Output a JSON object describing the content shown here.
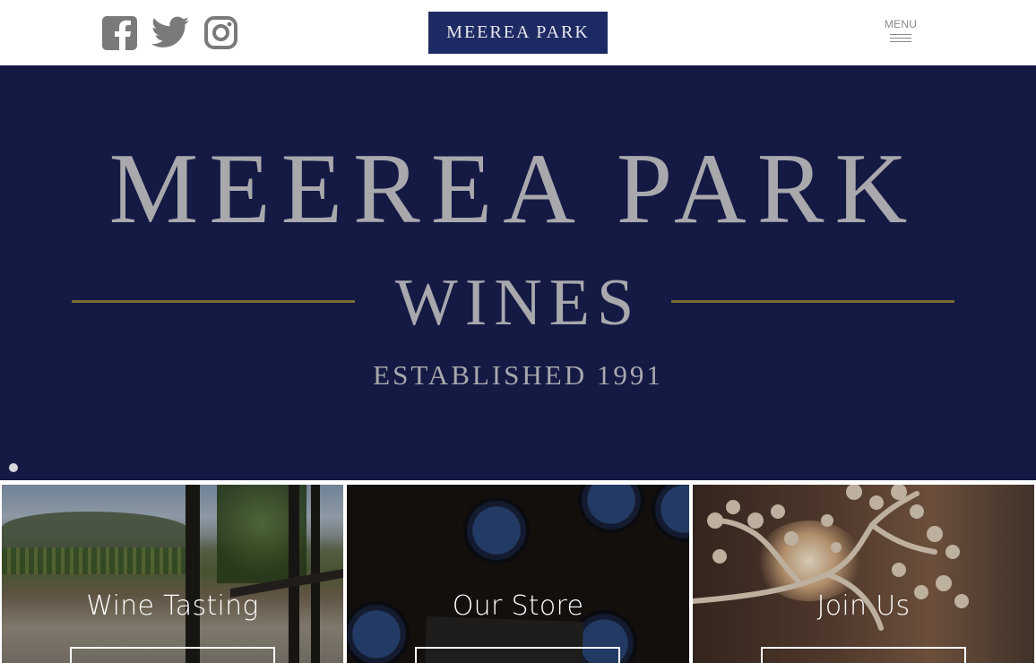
{
  "header": {
    "social": [
      {
        "icon": "facebook-icon",
        "label": "Facebook"
      },
      {
        "icon": "twitter-icon",
        "label": "Twitter"
      },
      {
        "icon": "instagram-icon",
        "label": "Instagram"
      }
    ],
    "logo_text": "MEEREA PARK",
    "menu_label": "MENU"
  },
  "hero": {
    "title": "MEEREA PARK",
    "subtitle": "WINES",
    "established": "ESTABLISHED 1991",
    "slide_count": 1,
    "active_slide": 1
  },
  "tiles": [
    {
      "label": "Wine Tasting"
    },
    {
      "label": "Our Store"
    },
    {
      "label": "Join Us"
    }
  ],
  "colors": {
    "brand_navy": "#1e2a63",
    "hero_bg": "#141a44",
    "hero_text": "#a8a8ad",
    "gold_rule": "#7d6a36",
    "icon_gray": "#7a7a7a"
  }
}
